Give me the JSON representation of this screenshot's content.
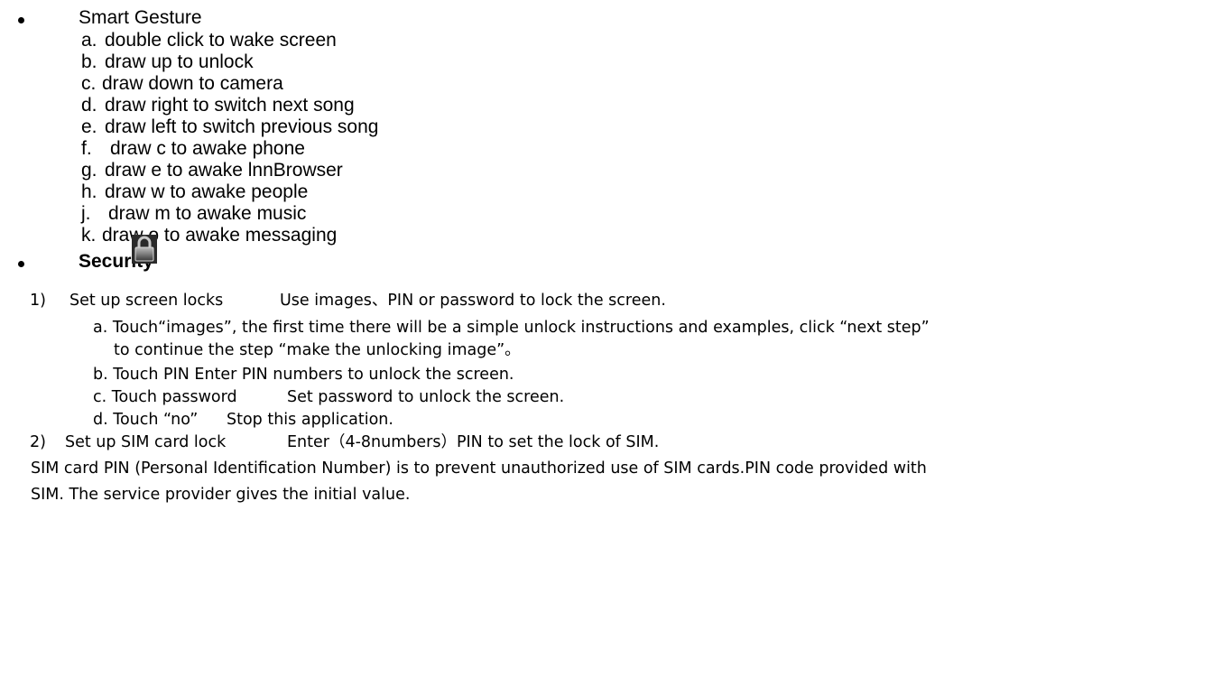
{
  "smart_gesture": {
    "title": "Smart Gesture",
    "items": [
      {
        "marker": "a.",
        "text": "double click to wake screen"
      },
      {
        "marker": "b.",
        "text": "draw up to unlock"
      },
      {
        "marker": "c.",
        "text": "draw down to camera"
      },
      {
        "marker": "d.",
        "text": "draw right to switch next song"
      },
      {
        "marker": "e.",
        "text": "draw left to switch previous song"
      },
      {
        "marker": "f.",
        "text": "draw c to awake phone"
      },
      {
        "marker": "g.",
        "text": "draw e to awake lnnBrowser"
      },
      {
        "marker": "h.",
        "text": "draw w to awake people"
      },
      {
        "marker": "j.",
        "text": "draw m to awake music"
      },
      {
        "marker": "k.",
        "text": "draw o to awake messaging"
      }
    ]
  },
  "security": {
    "title": "Security",
    "icon": "padlock-icon",
    "step1": {
      "marker": "1)",
      "title": "Set up screen locks",
      "desc": "Use images、PIN or password to lock the screen.",
      "sub_a_line1": "a. Touch“images”, the first time there will be a simple unlock instructions and examples, click “next step”",
      "sub_a_line2": "to continue the step “make the unlocking image”。",
      "sub_b": "b. Touch PIN Enter PIN numbers to unlock the screen.",
      "sub_c_label": "c. Touch password",
      "sub_c_desc": "Set password to unlock the screen.",
      "sub_d_label": "d. Touch “no”",
      "sub_d_desc": "Stop this application."
    },
    "step2": {
      "marker": "2)",
      "title": "Set up SIM card lock",
      "desc": "Enter（4-8numbers）PIN to set the lock of SIM."
    },
    "para_line1": "SIM card PIN (Personal Identification Number) is to prevent unauthorized use of SIM cards.PIN code provided with",
    "para_line2": "SIM. The service provider gives the initial value."
  }
}
